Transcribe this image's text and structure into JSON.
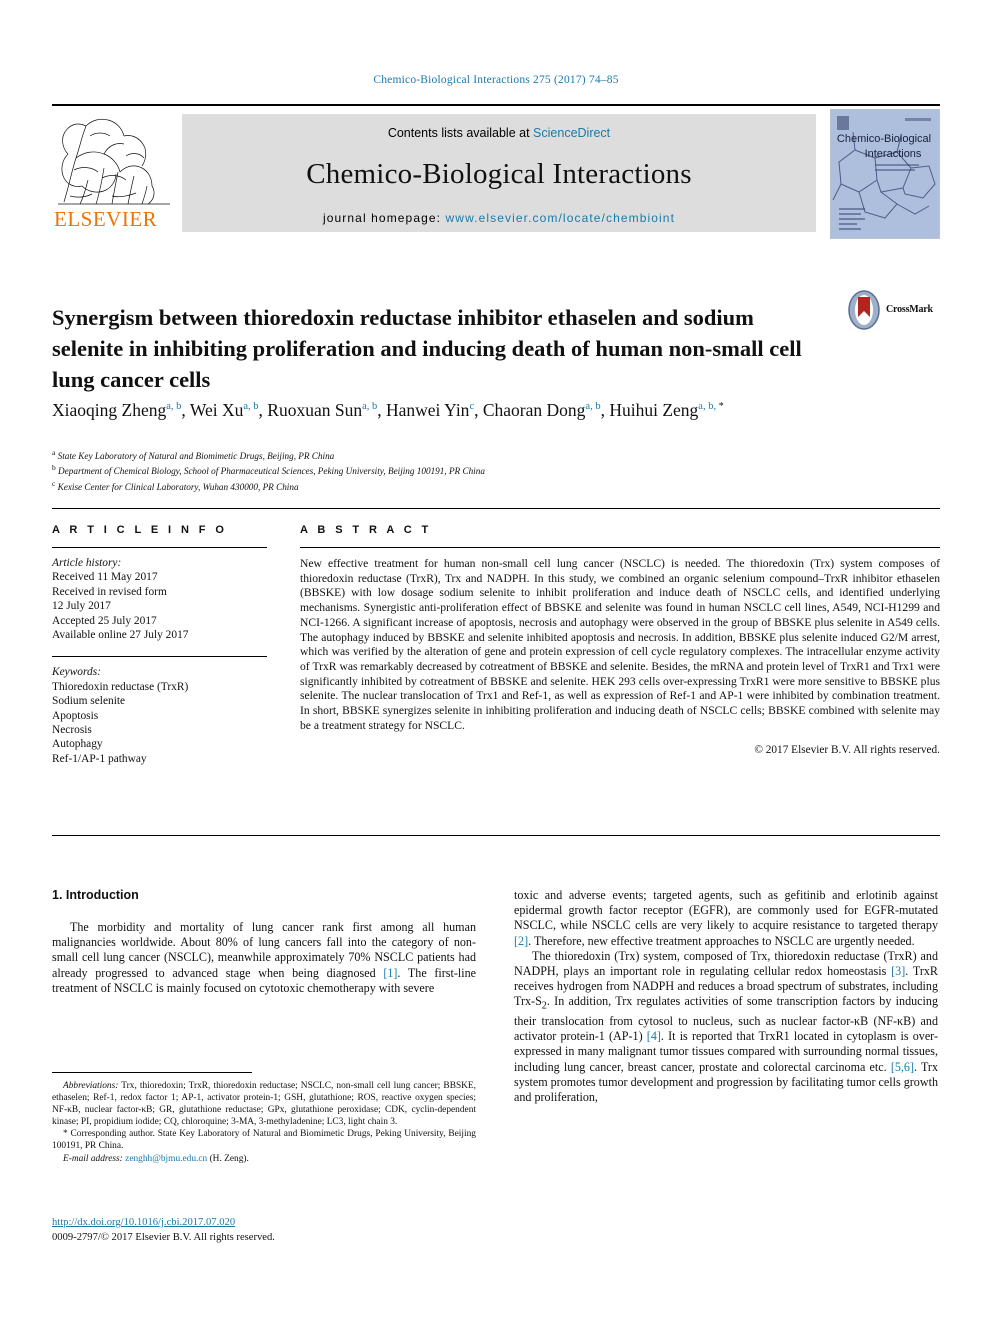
{
  "running_head": "Chemico-Biological Interactions 275 (2017) 74–85",
  "masthead": {
    "publisher": "ELSEVIER",
    "contents_prefix": "Contents lists available at",
    "contents_link": "ScienceDirect",
    "journal_name": "Chemico-Biological Interactions",
    "homepage_prefix": "journal homepage:",
    "homepage_url": "www.elsevier.com/locate/chembioint",
    "cover_title_line1": "Chemico-Biological",
    "cover_title_line2": "Interactions"
  },
  "article": {
    "title": "Synergism between thioredoxin reductase inhibitor ethaselen and sodium selenite in inhibiting proliferation and inducing death of human non-small cell lung cancer cells",
    "crossmark_label": "CrossMark",
    "authors": [
      {
        "name": "Xiaoqing Zheng",
        "marks": "a, b",
        "sep": ", "
      },
      {
        "name": "Wei Xu",
        "marks": "a, b",
        "sep": ", "
      },
      {
        "name": "Ruoxuan Sun",
        "marks": "a, b",
        "sep": ", "
      },
      {
        "name": "Hanwei Yin",
        "marks": "c",
        "sep": ", "
      },
      {
        "name": "Chaoran Dong",
        "marks": "a, b",
        "sep": ", "
      },
      {
        "name": "Huihui Zeng",
        "marks": "a, b, ",
        "star": "*",
        "sep": ""
      }
    ],
    "affiliations": [
      {
        "mark": "a",
        "text": "State Key Laboratory of Natural and Biomimetic Drugs, Beijing, PR China"
      },
      {
        "mark": "b",
        "text": "Department of Chemical Biology, School of Pharmaceutical Sciences, Peking University, Beijing 100191, PR China"
      },
      {
        "mark": "c",
        "text": "Kexise Center for Clinical Laboratory, Wuhan 430000, PR China"
      }
    ]
  },
  "article_info": {
    "heading": "A R T I C L E  I N F O",
    "history_label": "Article history:",
    "history": [
      "Received 11 May 2017",
      "Received in revised form",
      "12 July 2017",
      "Accepted 25 July 2017",
      "Available online 27 July 2017"
    ],
    "keywords_label": "Keywords:",
    "keywords": [
      "Thioredoxin reductase (TrxR)",
      "Sodium selenite",
      "Apoptosis",
      "Necrosis",
      "Autophagy",
      "Ref-1/AP-1 pathway"
    ]
  },
  "abstract": {
    "heading": "A B S T R A C T",
    "text": "New effective treatment for human non-small cell lung cancer (NSCLC) is needed. The thioredoxin (Trx) system composes of thioredoxin reductase (TrxR), Trx and NADPH. In this study, we combined an organic selenium compound–TrxR inhibitor ethaselen (BBSKE) with low dosage sodium selenite to inhibit proliferation and induce death of NSCLC cells, and identified underlying mechanisms. Synergistic anti-proliferation effect of BBSKE and selenite was found in human NSCLC cell lines, A549, NCI-H1299 and NCI-1266. A significant increase of apoptosis, necrosis and autophagy were observed in the group of BBSKE plus selenite in A549 cells. The autophagy induced by BBSKE and selenite inhibited apoptosis and necrosis. In addition, BBSKE plus selenite induced G2/M arrest, which was verified by the alteration of gene and protein expression of cell cycle regulatory complexes. The intracellular enzyme activity of TrxR was remarkably decreased by cotreatment of BBSKE and selenite. Besides, the mRNA and protein level of TrxR1 and Trx1 were significantly inhibited by cotreatment of BBSKE and selenite. HEK 293 cells over-expressing TrxR1 were more sensitive to BBSKE plus selenite. The nuclear translocation of Trx1 and Ref-1, as well as expression of Ref-1 and AP-1 were inhibited by combination treatment. In short, BBSKE synergizes selenite in inhibiting proliferation and inducing death of NSCLC cells; BBSKE combined with selenite may be a treatment strategy for NSCLC.",
    "copyright": "© 2017 Elsevier B.V. All rights reserved."
  },
  "body": {
    "section_heading": "1. Introduction",
    "left_paragraph_1_a": "The morbidity and mortality of lung cancer rank first among all human malignancies worldwide. About 80% of lung cancers fall into the category of non-small cell lung cancer (NSCLC), meanwhile approximately 70% NSCLC patients had already progressed to advanced stage when being diagnosed ",
    "left_ref_1": "[1]",
    "left_paragraph_1_b": ". The first-line treatment of NSCLC is mainly focused on cytotoxic chemotherapy with severe",
    "right_paragraph_1_a": "toxic and adverse events; targeted agents, such as gefitinib and erlotinib against epidermal growth factor receptor (EGFR), are commonly used for EGFR-mutated NSCLC, while NSCLC cells are very likely to acquire resistance to targeted therapy ",
    "right_ref_2": "[2]",
    "right_paragraph_1_b": ". Therefore, new effective treatment approaches to NSCLC are urgently needed.",
    "right_paragraph_2_a": "The thioredoxin (Trx) system, composed of Trx, thioredoxin reductase (TrxR) and NADPH, plays an important role in regulating cellular redox homeostasis ",
    "right_ref_3": "[3]",
    "right_paragraph_2_b": ". TrxR receives hydrogen from NADPH and reduces a broad spectrum of substrates, including Trx-S",
    "right_sub_2": "2",
    "right_paragraph_2_c": ". In addition, Trx regulates activities of some transcription factors by inducing their translocation from cytosol to nucleus, such as nuclear factor-κB (NF-κB) and activator protein-1 (AP-1) ",
    "right_ref_4": "[4]",
    "right_paragraph_2_d": ". It is reported that TrxR1 located in cytoplasm is over-expressed in many malignant tumor tissues compared with surrounding normal tissues, including lung cancer, breast cancer, prostate and colorectal carcinoma etc. ",
    "right_ref_56": "[5,6]",
    "right_paragraph_2_e": ". Trx system promotes tumor development and progression by facilitating tumor cells growth and proliferation,"
  },
  "footnotes": {
    "abbreviations_label": "Abbreviations:",
    "abbreviations_text": " Trx, thioredoxin; TrxR, thioredoxin reductase; NSCLC, non-small cell lung cancer; BBSKE, ethaselen; Ref-1, redox factor 1; AP-1, activator protein-1; GSH, glutathione; ROS, reactive oxygen species; NF-κB, nuclear factor-κB; GR, glutathione reductase; GPx, glutathione peroxidase; CDK, cyclin-dependent kinase; PI, propidium iodide; CQ, chloroquine; 3-MA, 3-methyladenine; LC3, light chain 3.",
    "corresponding_marker": "*",
    "corresponding_text": " Corresponding author. State Key Laboratory of Natural and Biomimetic Drugs, Peking University, Beijing 100191, PR China.",
    "email_label": "E-mail address:",
    "email": "zenghh@bjmu.edu.cn",
    "email_suffix": " (H. Zeng)."
  },
  "footer": {
    "doi_url": "http://dx.doi.org/10.1016/j.cbi.2017.07.020",
    "issn_line": "0009-2797/© 2017 Elsevier B.V. All rights reserved."
  },
  "colors": {
    "link": "#1a7aa8",
    "elsevier_orange": "#ec7404",
    "band_gray": "#dddddd",
    "cover_blue": "#aebedd"
  }
}
